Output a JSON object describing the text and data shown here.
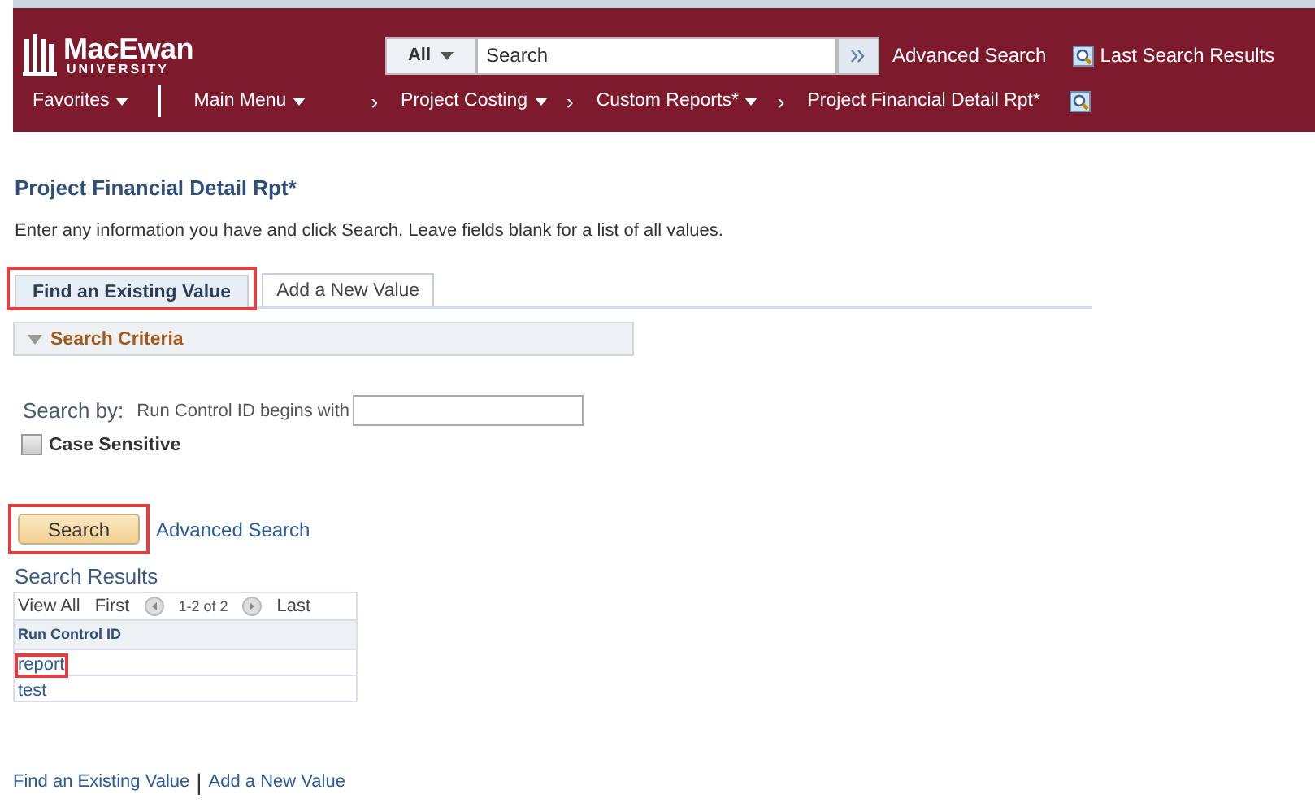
{
  "header": {
    "logo_name": "MacEwan",
    "logo_sub": "UNIVERSITY",
    "search_scope": "All",
    "search_placeholder": "Search",
    "links": [
      "Advanced Search",
      "Last Search Results"
    ]
  },
  "nav": {
    "favorites": "Favorites",
    "main_menu": "Main Menu",
    "separator": "›",
    "crumbs": [
      {
        "label": "Project Costing",
        "dropdown": true
      },
      {
        "label": "Custom Reports*",
        "dropdown": true
      },
      {
        "label": "Project Financial Detail Rpt*",
        "dropdown": false
      }
    ]
  },
  "page": {
    "title": "Project Financial Detail Rpt*",
    "instructions": "Enter any information you have and click Search. Leave fields blank for a list of all values."
  },
  "tabs": [
    {
      "label": "Find an Existing Value",
      "selected": true,
      "highlighted": true
    },
    {
      "label": "Add a New Value",
      "selected": false,
      "highlighted": false
    }
  ],
  "criteria": {
    "title": "Search Criteria",
    "expanded": true,
    "search_by": "Search by:",
    "field_label": "Run Control ID begins with",
    "case_sensitive": {
      "label": "Case Sensitive",
      "checked": false
    }
  },
  "search_button": {
    "label": "Search",
    "highlighted": true
  },
  "advanced_link": "Advanced Search",
  "results": {
    "title": "Search Results",
    "view_all": "View All",
    "first": "First",
    "count": "1-2 of 2",
    "last": "Last",
    "column": "Run Control ID",
    "rows": [
      {
        "value": "report",
        "highlighted": true
      },
      {
        "value": "test",
        "highlighted": false
      }
    ]
  },
  "footer_links": [
    "Find an Existing Value",
    "Add a New Value"
  ],
  "footer_separator": "|"
}
